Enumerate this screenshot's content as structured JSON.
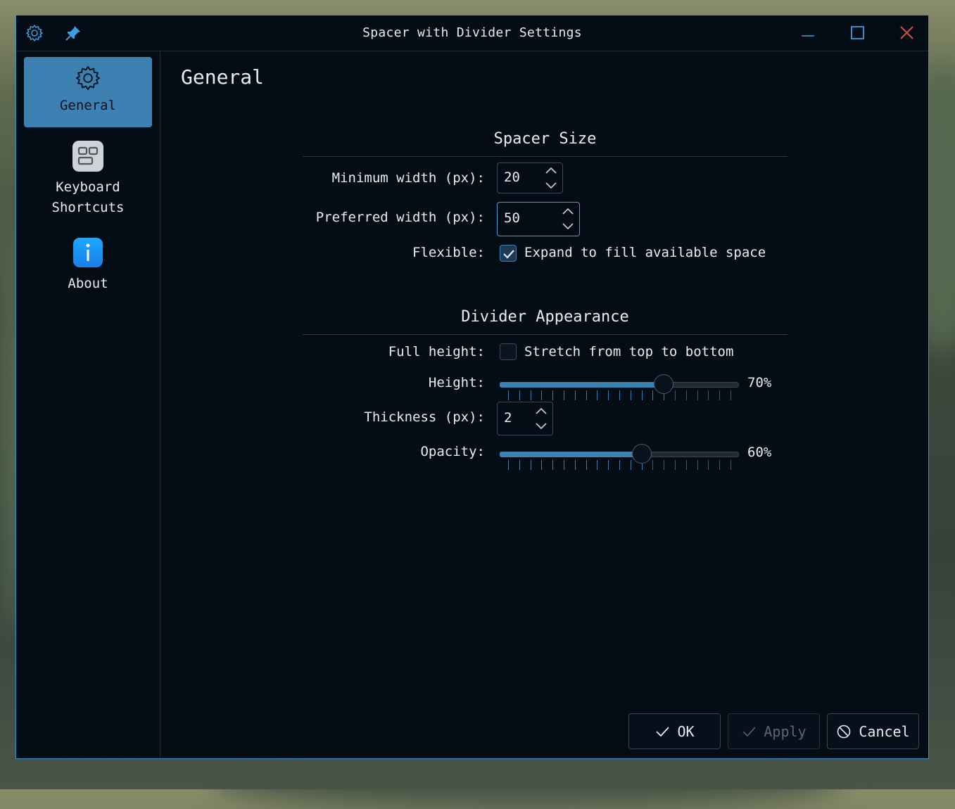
{
  "window": {
    "title": "Spacer with Divider Settings"
  },
  "titlebar": {
    "icons": [
      "settings-gear-icon",
      "pin-icon"
    ],
    "controls": [
      "minimize-icon",
      "maximize-icon",
      "close-icon"
    ]
  },
  "sidebar": {
    "items": [
      {
        "label": "General",
        "icon": "gear-icon",
        "active": true
      },
      {
        "label": "Keyboard\nShortcuts",
        "icon": "keyboard-icon",
        "active": false
      },
      {
        "label": "About",
        "icon": "info-icon",
        "active": false
      }
    ]
  },
  "page": {
    "title": "General"
  },
  "spacer_size": {
    "heading": "Spacer Size",
    "min_width_label": "Minimum width (px):",
    "min_width_value": "20",
    "pref_width_label": "Preferred width (px):",
    "pref_width_value": "50",
    "flexible_label": "Flexible:",
    "flexible_check_label": "Expand to fill available space",
    "flexible_checked": true
  },
  "divider": {
    "heading": "Divider Appearance",
    "full_height_label": "Full height:",
    "full_height_check_label": "Stretch from top to bottom",
    "full_height_checked": false,
    "height_label": "Height:",
    "height_value": 70,
    "height_display": "70%",
    "thickness_label": "Thickness (px):",
    "thickness_value": "2",
    "opacity_label": "Opacity:",
    "opacity_value": 60,
    "opacity_display": "60%"
  },
  "buttons": {
    "ok": "OK",
    "apply": "Apply",
    "cancel": "Cancel"
  },
  "colors": {
    "accent": "#3d80b2",
    "window_bg": "#040d16",
    "border": "#3b8fc4",
    "close": "#e0453a"
  }
}
